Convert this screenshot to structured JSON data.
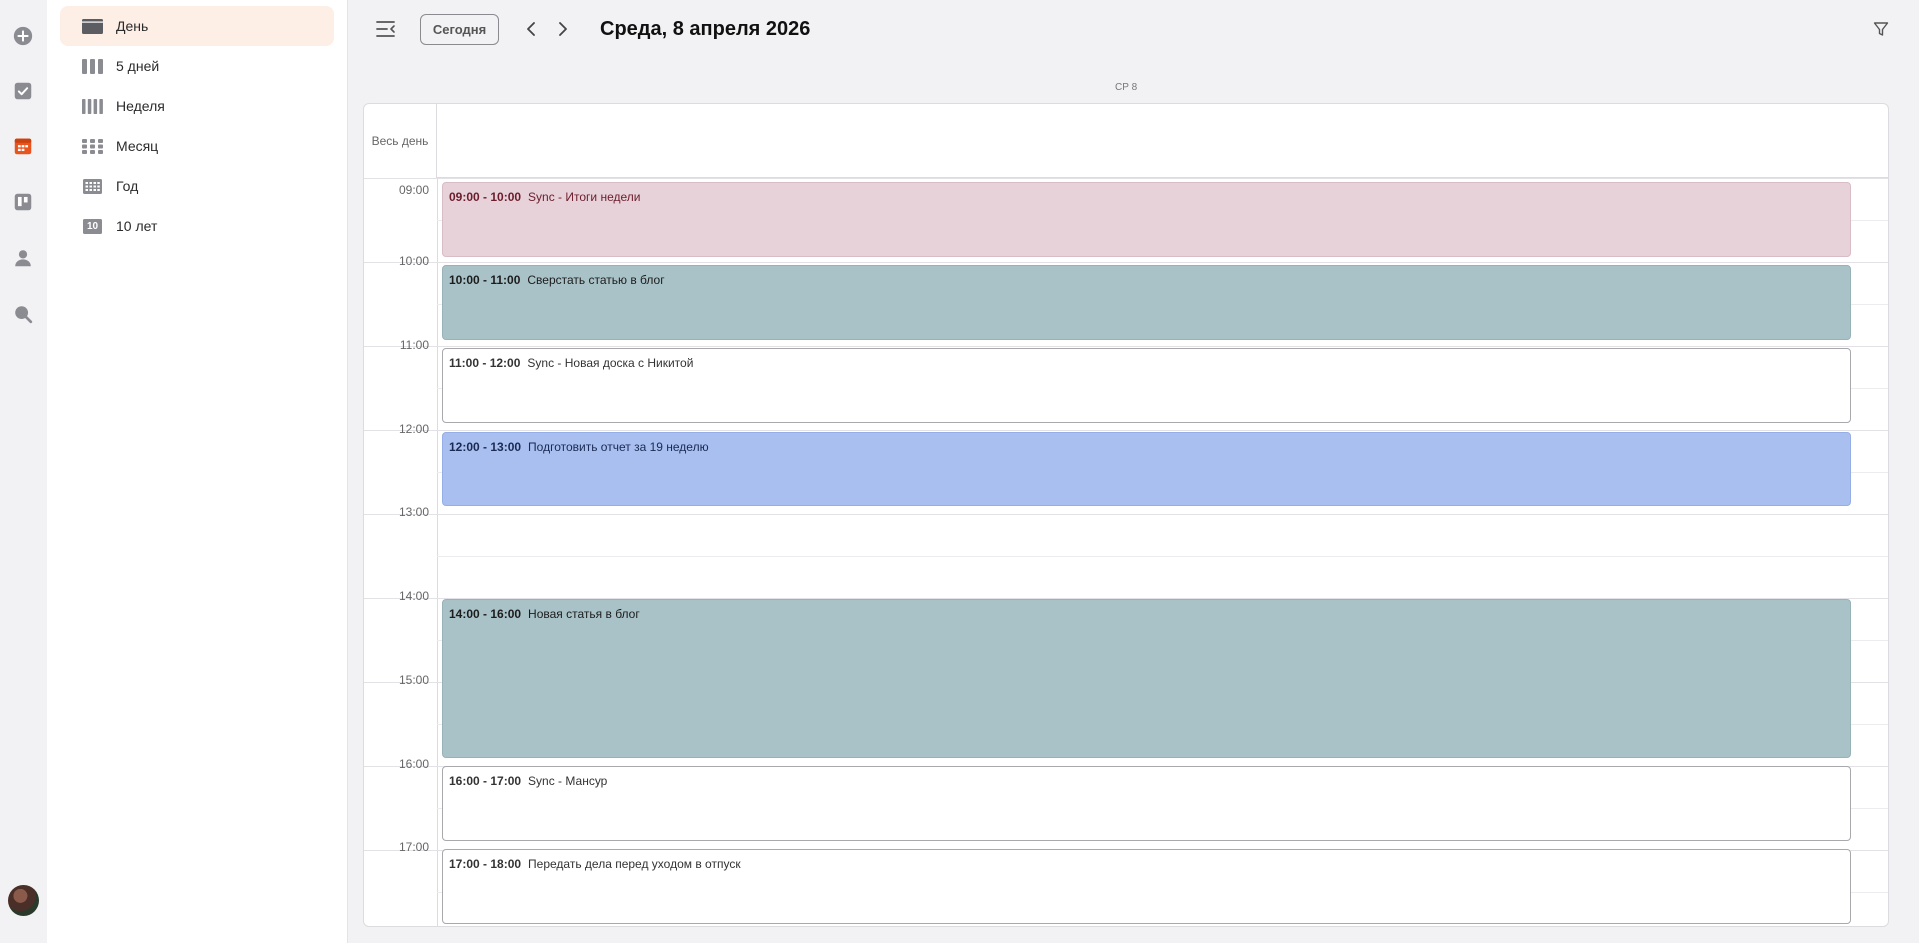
{
  "rail": {
    "icons": [
      "plus-circle-icon",
      "tasks-check-icon",
      "calendar-icon",
      "board-icon",
      "contacts-person-icon",
      "search-icon"
    ],
    "active_icon": "calendar-icon",
    "accent_color": "#e8541e"
  },
  "sidebar": {
    "views": [
      {
        "label": "День",
        "icon": "day-view-icon",
        "active": true
      },
      {
        "label": "5 дней",
        "icon": "five-days-view-icon",
        "active": false
      },
      {
        "label": "Неделя",
        "icon": "week-view-icon",
        "active": false
      },
      {
        "label": "Месяц",
        "icon": "month-view-icon",
        "active": false
      },
      {
        "label": "Год",
        "icon": "year-view-icon",
        "active": false
      },
      {
        "label": "10 лет",
        "icon": "ten-years-view-icon",
        "badge": "10",
        "active": false
      }
    ]
  },
  "toolbar": {
    "today_label": "Сегодня",
    "title": "Среда, 8 апреля 2026"
  },
  "calendar": {
    "day_header": "СР 8",
    "all_day_label": "Весь день",
    "hours": [
      "09:00",
      "10:00",
      "11:00",
      "12:00",
      "13:00",
      "14:00",
      "15:00",
      "16:00",
      "17:00"
    ],
    "events": [
      {
        "time": "09:00 - 10:00",
        "title": "Sync - Итоги недели",
        "color": "pink"
      },
      {
        "time": "10:00 - 11:00",
        "title": "Сверстать статью в блог",
        "color": "teal"
      },
      {
        "time": "11:00 - 12:00",
        "title": "Sync - Новая доска с Никитой",
        "color": "white"
      },
      {
        "time": "12:00 - 13:00",
        "title": "Подготовить отчет за 19 неделю",
        "color": "blue"
      },
      {
        "time": "14:00 - 16:00",
        "title": "Новая статья в блог",
        "color": "teal"
      },
      {
        "time": "16:00 - 17:00",
        "title": "Sync - Мансур",
        "color": "white"
      },
      {
        "time": "17:00 - 18:00",
        "title": "Передать дела перед уходом в отпуск",
        "color": "white"
      }
    ]
  }
}
